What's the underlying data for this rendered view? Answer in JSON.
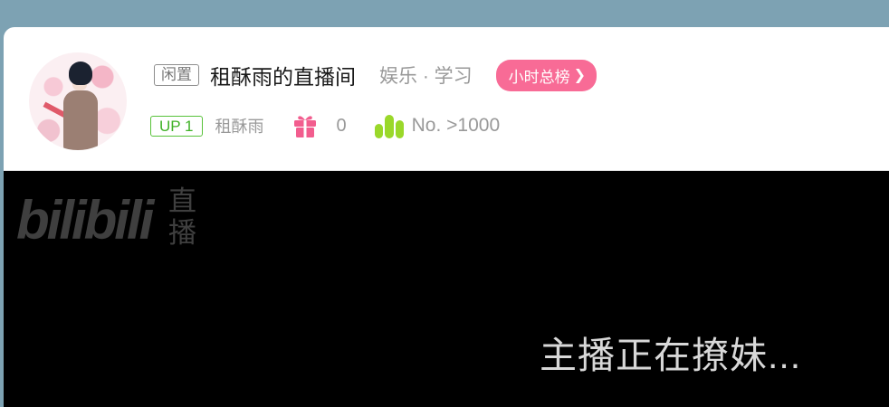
{
  "header": {
    "status_tag": "闲置",
    "room_title": "租酥雨的直播间",
    "area": "娱乐 · 学习",
    "rank_pill": "小时总榜",
    "up_badge": "UP 1",
    "username": "租酥雨",
    "gift_count": "0",
    "rank_text": "No. >1000"
  },
  "player": {
    "brand_word": "bilibili",
    "brand_live_1": "直",
    "brand_live_2": "播",
    "offline_message": "主播正在撩妹..."
  },
  "icons": {
    "gift": "gift-icon",
    "rank": "rank-bars-icon",
    "chevron": "chevron-right-icon"
  },
  "colors": {
    "rank_pill_bg": "#f86b96",
    "up_badge": "#58c23a",
    "gift_icon": "#f25d8e",
    "rank_icon": "#9ad82a",
    "player_bg": "#000000",
    "page_bg": "#7da2b3"
  }
}
